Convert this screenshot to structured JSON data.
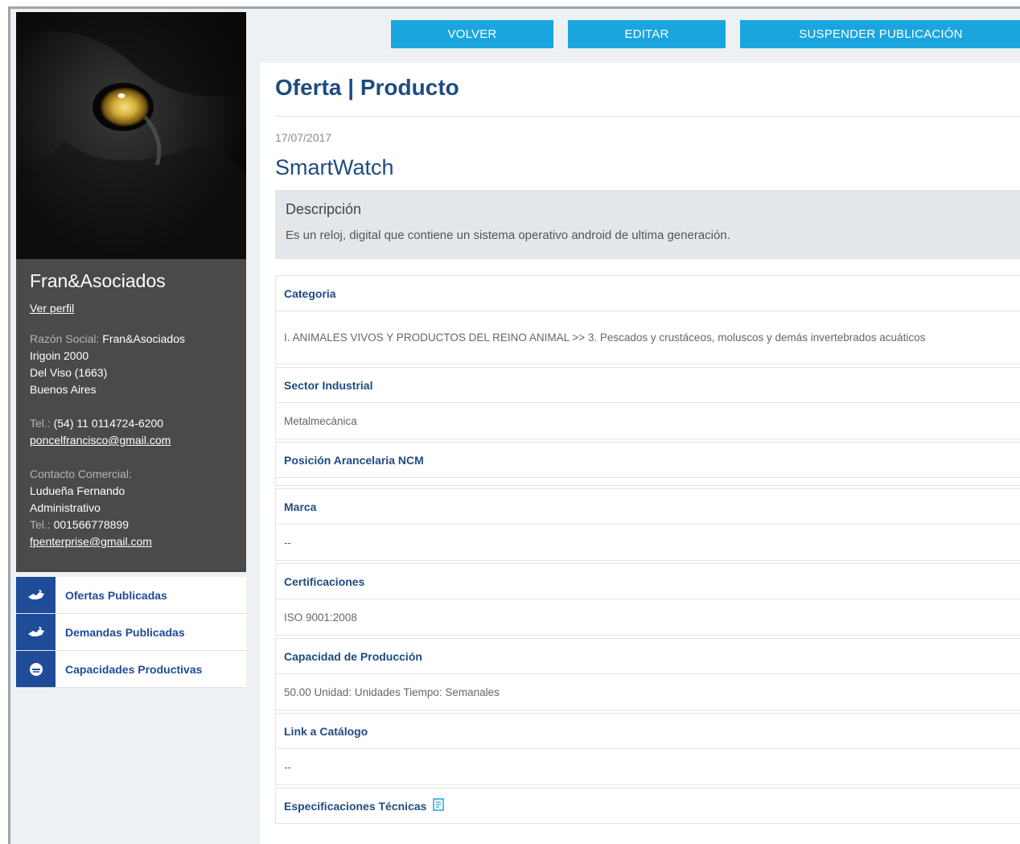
{
  "toolbar": {
    "volver": "VOLVER",
    "editar": "EDITAR",
    "suspender": "SUSPENDER PUBLICACIÓN"
  },
  "profile": {
    "company": "Fran&Asociados",
    "view_profile": "Ver perfil",
    "razon_label": "Razón Social:",
    "razon_value": "Fran&Asociados",
    "address_1": "Irigoin 2000",
    "address_2": "Del Viso (1663)",
    "address_3": "Buenos Aires",
    "tel_label": "Tel.:",
    "tel_value": "(54) 11 0114724-6200",
    "email": "poncelfrancisco@gmail.com",
    "contact_label": "Contacto Comercial:",
    "contact_name": "Ludueña Fernando",
    "contact_role": "Administrativo",
    "contact_tel_label": "Tel.:",
    "contact_tel_value": "001566778899",
    "contact_email": "fpenterprise@gmail.com"
  },
  "menu": [
    {
      "label": "Ofertas Publicadas",
      "icon": "handshake-icon"
    },
    {
      "label": "Demandas Publicadas",
      "icon": "handshake-icon"
    },
    {
      "label": "Capacidades Productivas",
      "icon": "gauge-icon"
    }
  ],
  "main": {
    "title": "Oferta | Producto",
    "date": "17/07/2017",
    "product": "SmartWatch",
    "desc_title": "Descripción",
    "desc_text": "Es un reloj, digital que contiene un sistema operativo android de ultima generación."
  },
  "fields": {
    "categoria_label": "Categoria",
    "categoria_value": "I. ANIMALES VIVOS Y PRODUCTOS DEL REINO ANIMAL >> 3. Pescados y crustáceos, moluscos y demás invertebrados acuáticos",
    "sector_label": "Sector Industrial",
    "sector_value": "Metalmecánica",
    "posicion_label": "Posición Arancelaria NCM",
    "marca_label": "Marca",
    "marca_value": "--",
    "cert_label": "Certificaciones",
    "cert_value": "ISO 9001:2008",
    "capacidad_label": "Capacidad de Producción",
    "capacidad_value": "50.00 Unidad: Unidades Tiempo: Semanales",
    "link_label": "Link a Catálogo",
    "link_value": "--",
    "espec_label": "Especificaciones Técnicas"
  }
}
